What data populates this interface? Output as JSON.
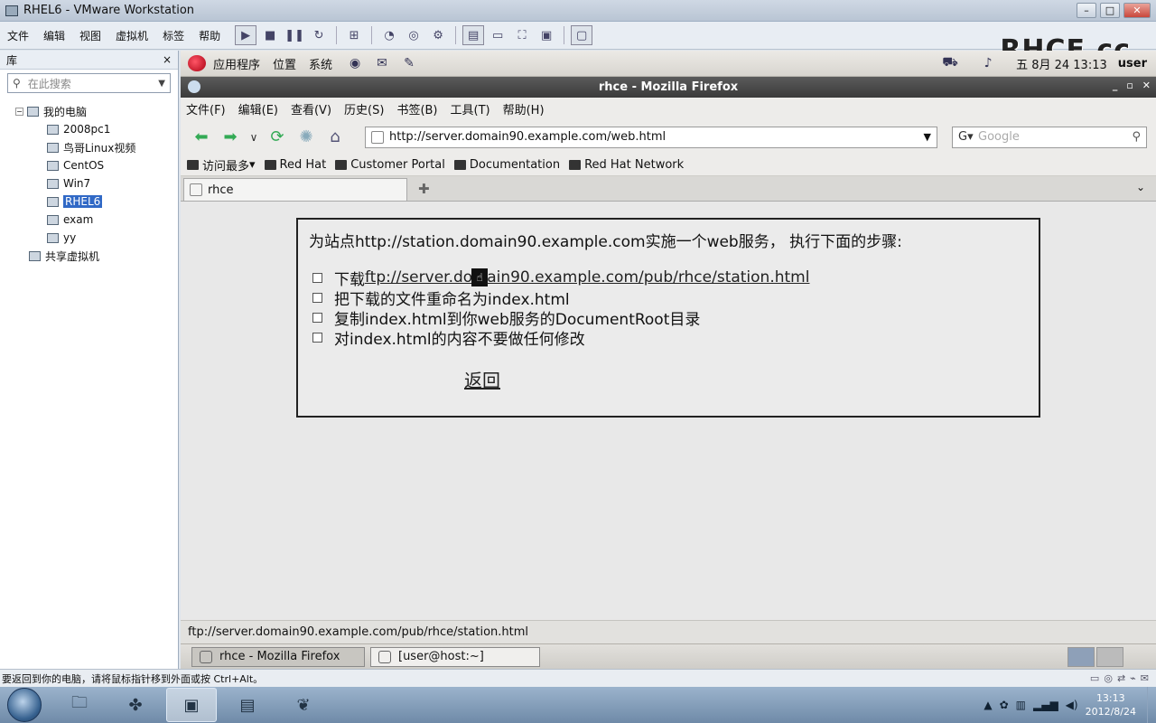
{
  "vm": {
    "title": "RHEL6 - VMware Workstation",
    "menu": [
      "文件",
      "编辑",
      "视图",
      "虚拟机",
      "标签",
      "帮助"
    ],
    "logo": "RHCE.cc",
    "status_hint": "要返回到你的电脑，请将鼠标指针移到外面或按 Ctrl+Alt。"
  },
  "library": {
    "title": "库",
    "close": "×",
    "search_placeholder": "在此搜索",
    "root": "我的电脑",
    "vms": [
      "2008pc1",
      "鸟哥Linux视频",
      "CentOS",
      "Win7",
      "RHEL6",
      "exam",
      "yy"
    ],
    "selected": "RHEL6",
    "shared": "共享虚拟机"
  },
  "gnome": {
    "menus": [
      "应用程序",
      "位置",
      "系统"
    ],
    "clock": "五  8月 24 13:13",
    "user": "user"
  },
  "firefox": {
    "title": "rhce - Mozilla Firefox",
    "menu": [
      "文件(F)",
      "编辑(E)",
      "查看(V)",
      "历史(S)",
      "书签(B)",
      "工具(T)",
      "帮助(H)"
    ],
    "url": "http://server.domain90.example.com/web.html",
    "search_placeholder": "Google",
    "bookmarks": [
      "访问最多",
      "Red Hat",
      "Customer Portal",
      "Documentation",
      "Red Hat Network"
    ],
    "tab_label": "rhce",
    "status_url": "ftp://server.domain90.example.com/pub/rhce/station.html"
  },
  "page": {
    "intro": "为站点http://station.domain90.example.com实施一个web服务， 执行下面的步骤:",
    "step1_prefix": "下载",
    "step1_link_a": "ftp://server.do",
    "step1_link_b": "ain90.example.com/pub/rhce/station.html",
    "step2": "把下载的文件重命名为index.html",
    "step3": "复制index.html到你web服务的DocumentRoot目录",
    "step4": "对index.html的内容不要做任何修改",
    "back": "返回"
  },
  "panel": {
    "tasks": [
      "rhce - Mozilla Firefox",
      "[user@host:~]"
    ]
  },
  "windows": {
    "time": "13:13",
    "date": "2012/8/24"
  }
}
